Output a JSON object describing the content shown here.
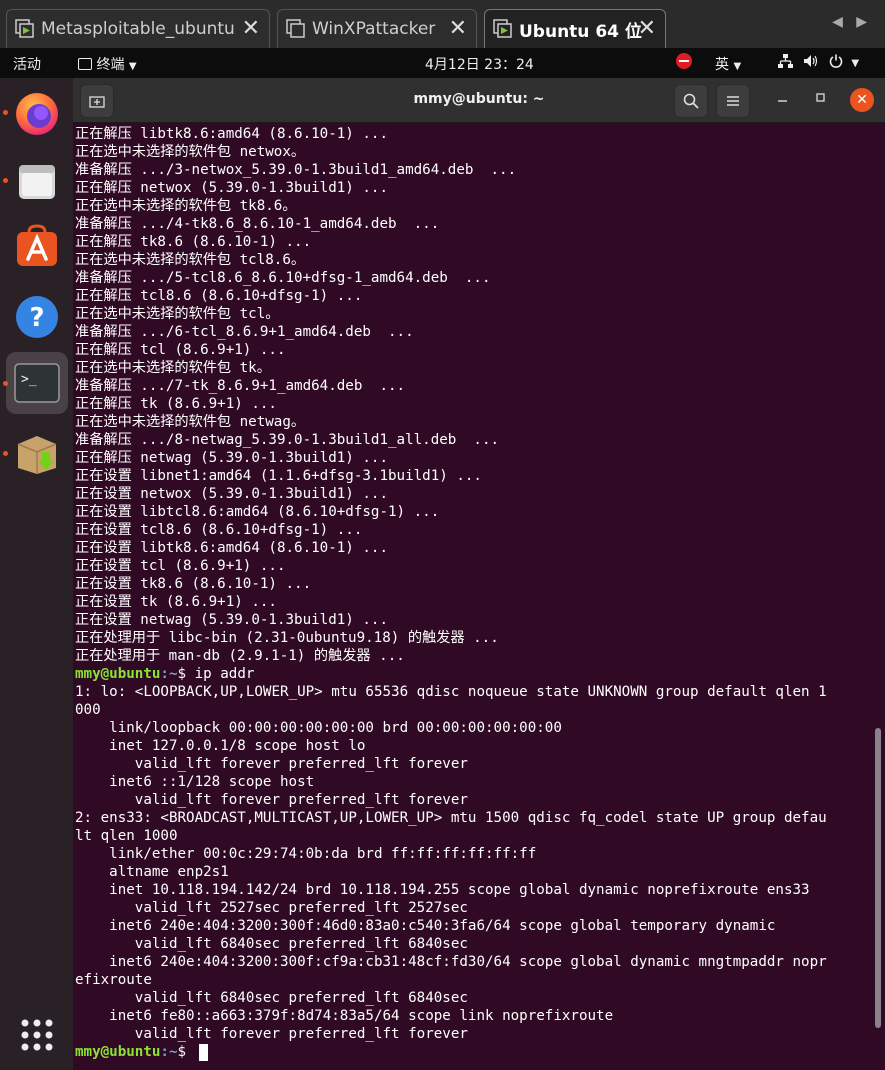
{
  "vm_tabs": [
    {
      "label": "Metasploitable_ubuntu",
      "active": false
    },
    {
      "label": "WinXPattacker",
      "active": false
    },
    {
      "label": "Ubuntu 64 位",
      "active": true
    }
  ],
  "topbar": {
    "activities": "活动",
    "app_menu": "终端",
    "clock": "4月12日  23：24",
    "input_method": "英"
  },
  "dock": {
    "items": [
      "firefox-icon",
      "files-icon",
      "software-icon",
      "help-icon",
      "terminal-icon",
      "package-installer-icon",
      "show-apps-icon"
    ]
  },
  "terminal": {
    "title": "mmy@ubuntu: ~",
    "prompt": {
      "user": "mmy@ubuntu",
      "path": ":~",
      "sym": "$ "
    },
    "lines": [
      {
        "t": "正在解压 libtk8.6:amd64 (8.6.10-1) ..."
      },
      {
        "t": "正在选中未选择的软件包 netwox。"
      },
      {
        "t": "准备解压 .../3-netwox_5.39.0-1.3build1_amd64.deb  ..."
      },
      {
        "t": "正在解压 netwox (5.39.0-1.3build1) ..."
      },
      {
        "t": "正在选中未选择的软件包 tk8.6。"
      },
      {
        "t": "准备解压 .../4-tk8.6_8.6.10-1_amd64.deb  ..."
      },
      {
        "t": "正在解压 tk8.6 (8.6.10-1) ..."
      },
      {
        "t": "正在选中未选择的软件包 tcl8.6。"
      },
      {
        "t": "准备解压 .../5-tcl8.6_8.6.10+dfsg-1_amd64.deb  ..."
      },
      {
        "t": "正在解压 tcl8.6 (8.6.10+dfsg-1) ..."
      },
      {
        "t": "正在选中未选择的软件包 tcl。"
      },
      {
        "t": "准备解压 .../6-tcl_8.6.9+1_amd64.deb  ..."
      },
      {
        "t": "正在解压 tcl (8.6.9+1) ..."
      },
      {
        "t": "正在选中未选择的软件包 tk。"
      },
      {
        "t": "准备解压 .../7-tk_8.6.9+1_amd64.deb  ..."
      },
      {
        "t": "正在解压 tk (8.6.9+1) ..."
      },
      {
        "t": "正在选中未选择的软件包 netwag。"
      },
      {
        "t": "准备解压 .../8-netwag_5.39.0-1.3build1_all.deb  ..."
      },
      {
        "t": "正在解压 netwag (5.39.0-1.3build1) ..."
      },
      {
        "t": "正在设置 libnet1:amd64 (1.1.6+dfsg-3.1build1) ..."
      },
      {
        "t": "正在设置 netwox (5.39.0-1.3build1) ..."
      },
      {
        "t": "正在设置 libtcl8.6:amd64 (8.6.10+dfsg-1) ..."
      },
      {
        "t": "正在设置 tcl8.6 (8.6.10+dfsg-1) ..."
      },
      {
        "t": "正在设置 libtk8.6:amd64 (8.6.10-1) ..."
      },
      {
        "t": "正在设置 tcl (8.6.9+1) ..."
      },
      {
        "t": "正在设置 tk8.6 (8.6.10-1) ..."
      },
      {
        "t": "正在设置 tk (8.6.9+1) ..."
      },
      {
        "t": "正在设置 netwag (5.39.0-1.3build1) ..."
      },
      {
        "t": "正在处理用于 libc-bin (2.31-0ubuntu9.18) 的触发器 ..."
      },
      {
        "t": "正在处理用于 man-db (2.9.1-1) 的触发器 ..."
      },
      {
        "p": true,
        "t": "ip addr"
      },
      {
        "t": "1: lo: <LOOPBACK,UP,LOWER_UP> mtu 65536 qdisc noqueue state UNKNOWN group default qlen 1"
      },
      {
        "t": "000"
      },
      {
        "t": "    link/loopback 00:00:00:00:00:00 brd 00:00:00:00:00:00"
      },
      {
        "t": "    inet 127.0.0.1/8 scope host lo"
      },
      {
        "t": "       valid_lft forever preferred_lft forever"
      },
      {
        "t": "    inet6 ::1/128 scope host "
      },
      {
        "t": "       valid_lft forever preferred_lft forever"
      },
      {
        "t": "2: ens33: <BROADCAST,MULTICAST,UP,LOWER_UP> mtu 1500 qdisc fq_codel state UP group defau"
      },
      {
        "t": "lt qlen 1000"
      },
      {
        "t": "    link/ether 00:0c:29:74:0b:da brd ff:ff:ff:ff:ff:ff"
      },
      {
        "t": "    altname enp2s1"
      },
      {
        "t": "    inet 10.118.194.142/24 brd 10.118.194.255 scope global dynamic noprefixroute ens33"
      },
      {
        "t": "       valid_lft 2527sec preferred_lft 2527sec"
      },
      {
        "t": "    inet6 240e:404:3200:300f:46d0:83a0:c540:3fa6/64 scope global temporary dynamic "
      },
      {
        "t": "       valid_lft 6840sec preferred_lft 6840sec"
      },
      {
        "t": "    inet6 240e:404:3200:300f:cf9a:cb31:48cf:fd30/64 scope global dynamic mngtmpaddr nopr"
      },
      {
        "t": "efixroute "
      },
      {
        "t": "       valid_lft 6840sec preferred_lft 6840sec"
      },
      {
        "t": "    inet6 fe80::a663:379f:8d74:83a5/64 scope link noprefixroute "
      },
      {
        "t": "       valid_lft forever preferred_lft forever"
      },
      {
        "p": true,
        "t": "",
        "cursor": true
      }
    ]
  }
}
